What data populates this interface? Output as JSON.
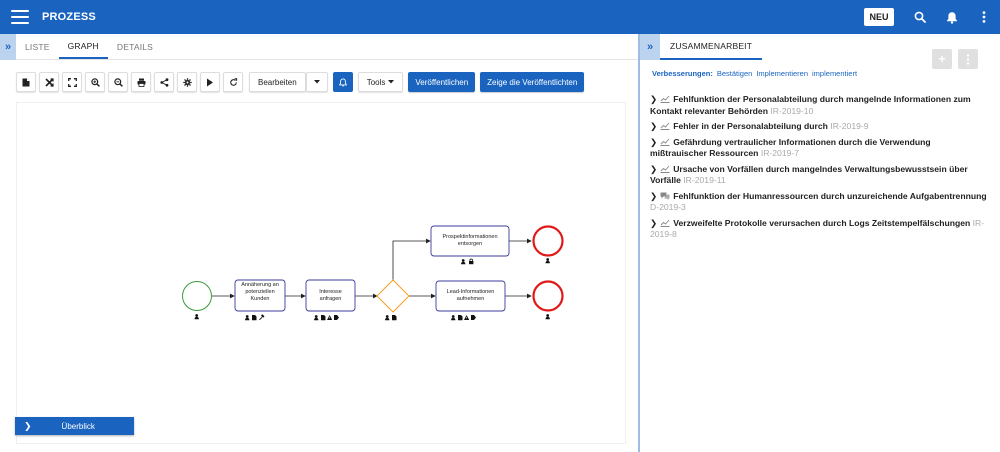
{
  "app": {
    "title": "PROZESS",
    "new_button": "NEU"
  },
  "tabs": [
    {
      "label": "LISTE",
      "active": false
    },
    {
      "label": "GRAPH",
      "active": true
    },
    {
      "label": "DETAILS",
      "active": false
    }
  ],
  "toolbar": {
    "icons": [
      "document-icon",
      "shuffle-icon",
      "fullscreen-icon",
      "zoom-in-icon",
      "zoom-out-icon",
      "print-icon",
      "share-icon",
      "settings-icon",
      "play-icon",
      "refresh-icon"
    ],
    "edit_label": "Bearbeiten",
    "tools_label": "Tools",
    "publish_label": "Veröffentlichen",
    "show_published_label": "Zeige die Veröffentlichten"
  },
  "diagram": {
    "nodes": {
      "task1": "Annäherung an potenziellen Kunden",
      "task2": "Interesse anfragen",
      "task3": "Prospektinformationen entsorgen",
      "task4": "Lead-Informationen aufnehmen"
    }
  },
  "overview_label": "Überblick",
  "collab": {
    "tab_label": "ZUSAMMENARBEIT",
    "improvements_label": "Verbesserungen:",
    "links": [
      "Bestätigen",
      "Implementieren",
      "implementiert"
    ],
    "issues": [
      {
        "title": "Fehlfunktion der Personalabteilung durch mangelnde Informationen zum Kontakt relevanter Behörden",
        "id": "IR-2019-10",
        "icon": "chart-icon"
      },
      {
        "title": "Fehler in der Personalabteilung durch",
        "id": "IR-2019-9",
        "icon": "chart-icon"
      },
      {
        "title": "Gefährdung vertraulicher Informationen durch die Verwendung mißtrauischer Ressourcen",
        "id": "IR-2019-7",
        "icon": "chart-icon"
      },
      {
        "title": "Ursache von Vorfällen durch mangelndes Verwaltungsbewusstsein über Vorfälle",
        "id": "IR-2019-11",
        "icon": "chart-icon"
      },
      {
        "title": "Fehlfunktion der Humanressourcen durch unzureichende Aufgabentrennung",
        "id": "D-2019-3",
        "icon": "chat-icon"
      },
      {
        "title": "Verzweifelte Protokolle verursachen durch Logs Zeitstempelfälschungen",
        "id": "IR-2019-8",
        "icon": "chart-icon"
      }
    ]
  },
  "colors": {
    "primary": "#1a64c0",
    "start_event": "#3a9a3a",
    "end_event": "#e01818",
    "gateway": "#f0a020"
  }
}
